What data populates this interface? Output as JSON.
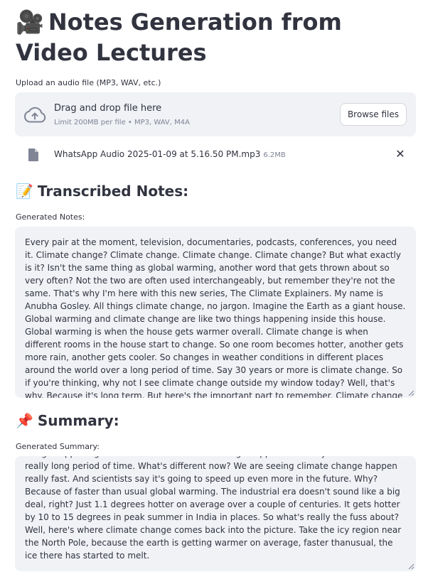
{
  "page": {
    "title_emoji": "🎥",
    "title": "Notes Generation from Video Lectures"
  },
  "upload": {
    "label": "Upload an audio file (MP3, WAV, etc.)",
    "dropzone_title": "Drag and drop file here",
    "dropzone_limit": "Limit 200MB per file • MP3, WAV, M4A",
    "browse_label": "Browse files",
    "icon": "cloud-upload-icon"
  },
  "file": {
    "name": "WhatsApp Audio 2025-01-09 at 5.16.50 PM.mp3",
    "size": "6.2MB",
    "remove_glyph": "✕",
    "icon": "file-icon"
  },
  "transcribed": {
    "emoji": "📝",
    "heading": "Transcribed Notes:",
    "field_label": "Generated Notes:",
    "text": " Every pair at the moment, television, documentaries, podcasts, conferences, you need it. Climate change? Climate change. Climate change. Climate change? But what exactly is it? Isn't the same thing as global warming, another word that gets thrown about so very often? Not the two are often used interchangeably, but remember they're not the same. That's why I'm here with this new series, The Climate Explainers. My name is Anubha Gosley. All things climate change, no jargon. Imagine the Earth as a giant house. Global warming and climate change are like two things happening inside this house. Global warming is when the house gets warmer overall. Climate change is when different rooms in the house start to change. So one room becomes hotter, another gets more rain, another gets cooler. So changes in weather conditions in different places around the world over a long period of time. Say 30 years or more is climate change. So if you're thinking, why not I see climate change outside my window today? Well, that's why. Because it's long term. But here's the important part to remember. Climate change happens naturally as well over a really long period of time. What's different now? The reason we're talking about it is we are seeing climate change happen really fast."
  },
  "summary": {
    "emoji": "📌",
    "heading": "Summary:",
    "field_label": "Generated Summary:",
    "text": "Imagine the Earth as a giant house. Global warming and climate change are like two things happening inside this house. Global warming and climate change are like two things happening inside this house. Climate change happens naturally as well over a really long period of time. What's different now? We are seeing climate change happen really fast. And scientists say it's going to speed up even more in the future. Why? Because of faster than usual global warming. The industrial era doesn't sound like a big deal, right? Just 1.1 degrees hotter on average over a couple of centuries. It gets hotter by 10 to 15 degrees in peak summer in India in places. So what's really the fuss about? Well, here's where climate change comes back into the picture. Take the icy region near the North Pole, because the earth is getting warmer on average, faster thanusual, the ice there has started to melt."
  }
}
